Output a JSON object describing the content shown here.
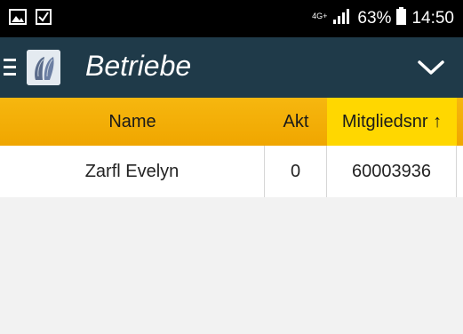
{
  "statusbar": {
    "network": "4G+",
    "battery": "63%",
    "time": "14:50"
  },
  "appbar": {
    "title": "Betriebe",
    "menu_icon": "hamburger-icon",
    "logo_icon": "app-logo",
    "dropdown_icon": "chevron-down-icon"
  },
  "table": {
    "columns": {
      "name": "Name",
      "akt": "Akt",
      "mitgliedsnr": "Mitgliedsnr ↑"
    },
    "rows": [
      {
        "name": "Zarfl Evelyn",
        "akt": "0",
        "mitgliedsnr": "60003936"
      }
    ]
  },
  "colors": {
    "appbar": "#1f3a49",
    "header": "#f2ab00",
    "sorted_header": "#ffd700"
  }
}
